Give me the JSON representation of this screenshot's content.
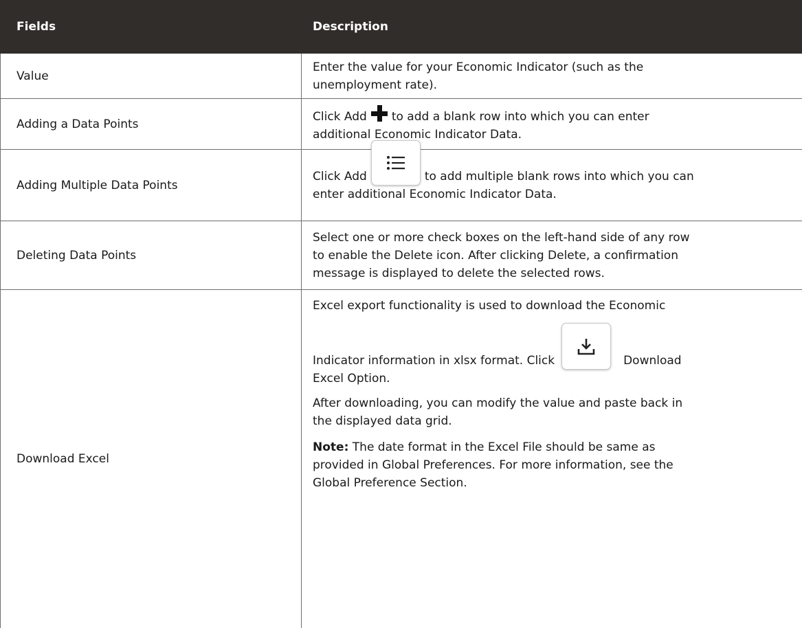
{
  "table": {
    "header": {
      "fields": "Fields",
      "description": "Description"
    },
    "rows": {
      "value": {
        "field": "Value",
        "line1": "Enter the value for your Economic Indicator (such as the",
        "line2": "unemployment rate)."
      },
      "add_point": {
        "field": "Adding a Data Points",
        "pre": "Click Add",
        "post": "to add a blank row into which you can enter",
        "line2": "additional Economic Indicator Data.",
        "icon": "plus-icon"
      },
      "add_multiple": {
        "field": "Adding Multiple Data Points",
        "pre": "Click Add",
        "post": "to add multiple blank rows into which you can",
        "line2": "enter additional Economic Indicator Data.",
        "icon": "list-icon"
      },
      "delete": {
        "field": "Deleting Data Points",
        "line1": "Select one or more check boxes on the left-hand side of any row",
        "line2": "to enable the Delete icon. After clicking Delete, a confirmation",
        "line3": "message is displayed to delete the selected rows."
      },
      "download": {
        "field": "Download Excel",
        "line1": "Excel export functionality is used to download the Economic",
        "pre": "Indicator information in xlsx format. Click",
        "post": "Download",
        "line3": "Excel Option.",
        "para2_line1": "After downloading, you can modify the value and paste back in",
        "para2_line2": "the displayed data grid.",
        "note_label": "Note:",
        "note_line1": " The date format in the Excel File should be same as",
        "note_line2": "provided in Global Preferences. For more information, see the",
        "note_line3": "Global Preference Section.",
        "icon": "download-icon"
      }
    }
  }
}
